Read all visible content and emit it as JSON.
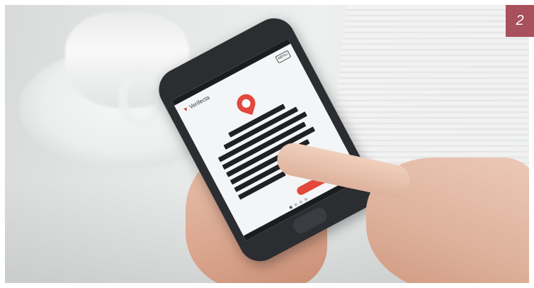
{
  "badge": {
    "number": "2"
  },
  "phone_screen": {
    "logo_text": "Verifecta",
    "menu_label": "MENU",
    "carousel": {
      "dots": 4,
      "active_index": 0
    }
  },
  "colors": {
    "badge_bg": "#a8505c",
    "accent_red": "#e2483b",
    "phone_body": "#2b2d31"
  }
}
